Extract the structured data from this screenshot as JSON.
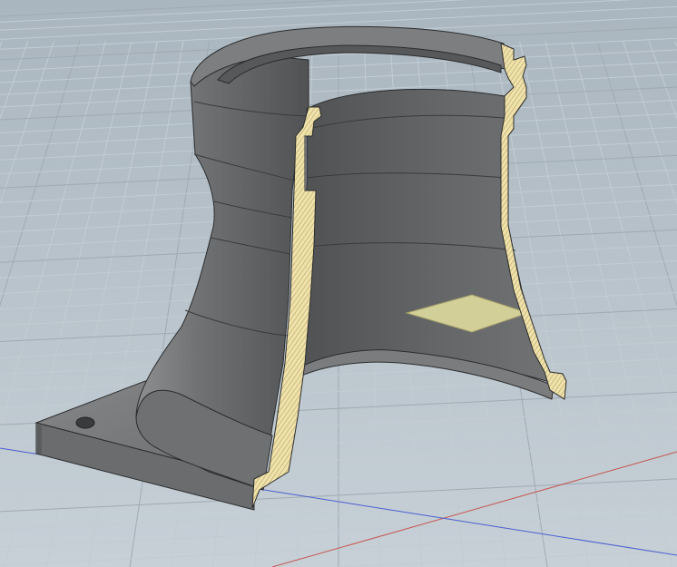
{
  "viewport": {
    "background_top": "#aab6bf",
    "background_bottom": "#c7d0d7",
    "grid_minor_color": "#c2ccd3",
    "grid_major_color": "#9faab3",
    "axis_x_color": "#c8554f",
    "axis_y_color": "#4a5fd0"
  },
  "model": {
    "body_color": "#6c6e70",
    "body_light": "#8a8c8e",
    "body_dark": "#4c4e50",
    "interior_color": "#5e6062",
    "section_fill": "#efe2aa",
    "section_hatch": "#b6a26a",
    "section_plane_color": "#d9d59b",
    "edge_color": "#2b2c2d"
  }
}
